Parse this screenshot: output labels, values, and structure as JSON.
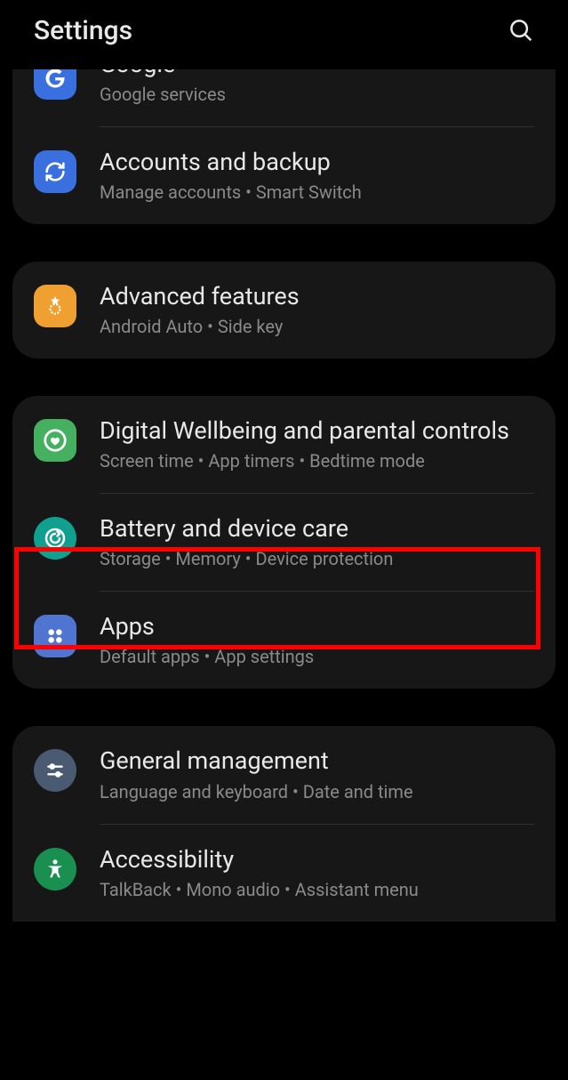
{
  "header": {
    "title": "Settings"
  },
  "groups": [
    {
      "items": [
        {
          "key": "google",
          "title": "Google",
          "subtitle": "Google services",
          "icon": "google",
          "iconBg": "#3a6fe0",
          "partial": true
        },
        {
          "key": "accounts-backup",
          "title": "Accounts and backup",
          "subtitle": "Manage accounts  •  Smart Switch",
          "icon": "sync",
          "iconBg": "#3a6fe0"
        }
      ]
    },
    {
      "items": [
        {
          "key": "advanced-features",
          "title": "Advanced features",
          "subtitle": "Android Auto  •  Side key",
          "icon": "star-gear",
          "iconBg": "#f0a030"
        }
      ]
    },
    {
      "items": [
        {
          "key": "digital-wellbeing",
          "title": "Digital Wellbeing and parental controls",
          "subtitle": "Screen time  •  App timers  •  Bedtime mode",
          "icon": "heart-circle",
          "iconBg": "#45b060"
        },
        {
          "key": "battery-device-care",
          "title": "Battery and device care",
          "subtitle": "Storage  •  Memory  •  Device protection",
          "icon": "care-circle",
          "iconBg": "#10a090",
          "highlighted": true
        },
        {
          "key": "apps",
          "title": "Apps",
          "subtitle": "Default apps  •  App settings",
          "icon": "four-dots",
          "iconBg": "#5075d0"
        }
      ]
    },
    {
      "items": [
        {
          "key": "general-management",
          "title": "General management",
          "subtitle": "Language and keyboard  •  Date and time",
          "icon": "sliders",
          "iconBg": "#4a5a70"
        },
        {
          "key": "accessibility",
          "title": "Accessibility",
          "subtitle": "TalkBack  •  Mono audio  •  Assistant menu",
          "icon": "person-circle",
          "iconBg": "#1a9050"
        }
      ]
    }
  ]
}
